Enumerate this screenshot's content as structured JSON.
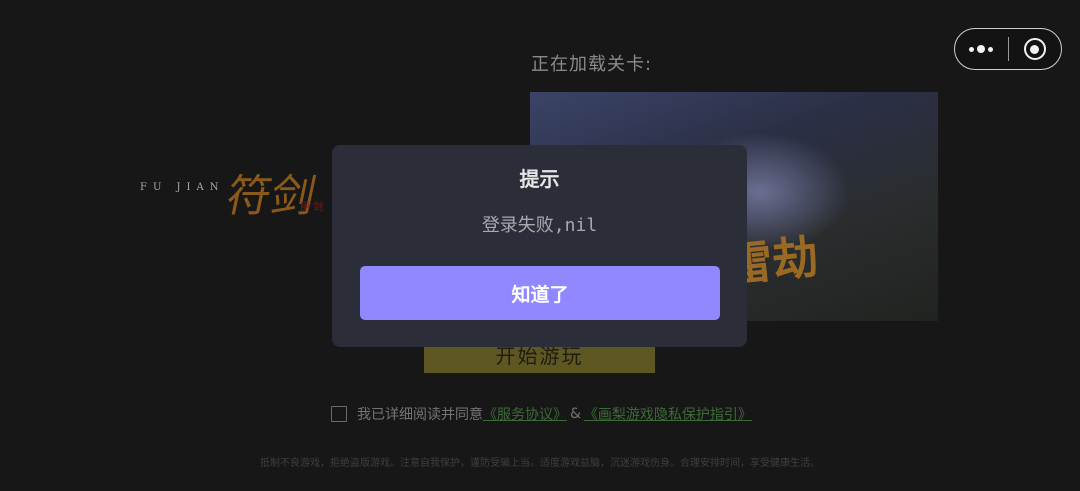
{
  "background": {
    "loading_label": "正在加载关卡:",
    "logo": {
      "en": "FU JIAN",
      "cn": "符剑",
      "sub": "丽 剑"
    },
    "level_title": "雷劫",
    "start_button": "开始游玩",
    "agreement": {
      "prefix": "我已详细阅读并同意",
      "service_link": "《服务协议》",
      "amp": "&",
      "privacy_link": "《画梨游戏隐私保护指引》"
    },
    "health_notice": "抵制不良游戏，拒绝盗版游戏。注意自我保护，谨防受骗上当。适度游戏益脑，沉迷游戏伤身。合理安排时间，享受健康生活。"
  },
  "capsule": {
    "more_icon": "more-dots-icon",
    "close_icon": "target-close-icon"
  },
  "modal": {
    "title": "提示",
    "content": "登录失败,nil",
    "confirm_label": "知道了",
    "confirm_color": "#8f88ff"
  }
}
